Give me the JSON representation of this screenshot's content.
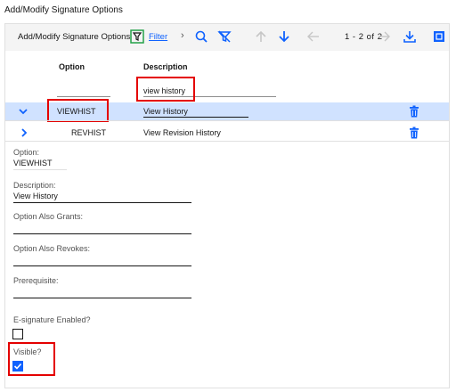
{
  "page": {
    "title": "Add/Modify Signature Options"
  },
  "toolbar": {
    "title": "Add/Modify Signature Options",
    "filter_label": "Filter",
    "pager": "1 - 2 of 2",
    "icons": [
      "filter-icon",
      "chevron-right-icon",
      "search-icon",
      "clear-filter-icon",
      "arrow-up-icon",
      "arrow-down-icon",
      "previous-page-icon",
      "next-page-icon",
      "download-icon",
      "expand-icon"
    ]
  },
  "table": {
    "columns": [
      "Option",
      "Description"
    ],
    "filters": {
      "option": "",
      "description": "view history"
    },
    "rows": [
      {
        "option": "VIEWHIST",
        "description": "View History",
        "expanded": true,
        "selected": true
      },
      {
        "option": "REVHIST",
        "description": "View Revision History",
        "expanded": false,
        "selected": false
      }
    ]
  },
  "detail": {
    "option_label": "Option:",
    "option_value": "VIEWHIST",
    "description_label": "Description:",
    "description_value": "View History",
    "grants_label": "Option Also Grants:",
    "grants_value": "",
    "revokes_label": "Option Also Revokes:",
    "revokes_value": "",
    "prereq_label": "Prerequisite:",
    "prereq_value": "",
    "esig_label": "E-signature Enabled?",
    "esig_checked": false,
    "visible_label": "Visible?",
    "visible_checked": true
  },
  "colors": {
    "accent": "#0f62fe",
    "row_selected": "#d0e2ff",
    "highlight": "#e40000",
    "filter_green": "#24a148"
  }
}
